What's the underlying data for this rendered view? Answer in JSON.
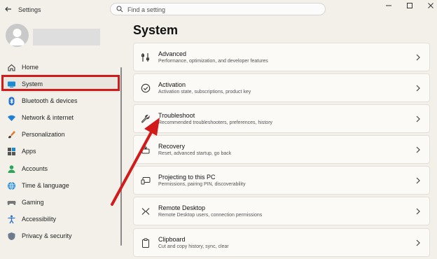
{
  "window": {
    "title": "Settings"
  },
  "search": {
    "placeholder": "Find a setting"
  },
  "sidebar": {
    "items": [
      {
        "label": "Home",
        "icon": "home-icon"
      },
      {
        "label": "System",
        "icon": "system-icon",
        "active": true
      },
      {
        "label": "Bluetooth & devices",
        "icon": "bluetooth-icon"
      },
      {
        "label": "Network & internet",
        "icon": "wifi-icon"
      },
      {
        "label": "Personalization",
        "icon": "brush-icon"
      },
      {
        "label": "Apps",
        "icon": "apps-icon"
      },
      {
        "label": "Accounts",
        "icon": "account-icon"
      },
      {
        "label": "Time & language",
        "icon": "globe-icon"
      },
      {
        "label": "Gaming",
        "icon": "gaming-icon"
      },
      {
        "label": "Accessibility",
        "icon": "accessibility-icon"
      },
      {
        "label": "Privacy & security",
        "icon": "shield-icon"
      }
    ]
  },
  "main": {
    "title": "System",
    "cards": [
      {
        "title": "Advanced",
        "desc": "Performance, optimization, and developer features",
        "icon": "advanced-tools-icon"
      },
      {
        "title": "Activation",
        "desc": "Activation state, subscriptions, product key",
        "icon": "activation-check-icon"
      },
      {
        "title": "Troubleshoot",
        "desc": "Recommended troubleshooters, preferences, history",
        "icon": "wrench-icon"
      },
      {
        "title": "Recovery",
        "desc": "Reset, advanced startup, go back",
        "icon": "recovery-icon"
      },
      {
        "title": "Projecting to this PC",
        "desc": "Permissions, pairing PIN, discoverability",
        "icon": "projecting-icon"
      },
      {
        "title": "Remote Desktop",
        "desc": "Remote Desktop users, connection permissions",
        "icon": "remote-desktop-icon"
      },
      {
        "title": "Clipboard",
        "desc": "Cut and copy history, sync, clear",
        "icon": "clipboard-icon"
      }
    ]
  },
  "colors": {
    "highlight": "#d11a1a",
    "accent": "#0067c0",
    "background": "#f3f0ea"
  }
}
